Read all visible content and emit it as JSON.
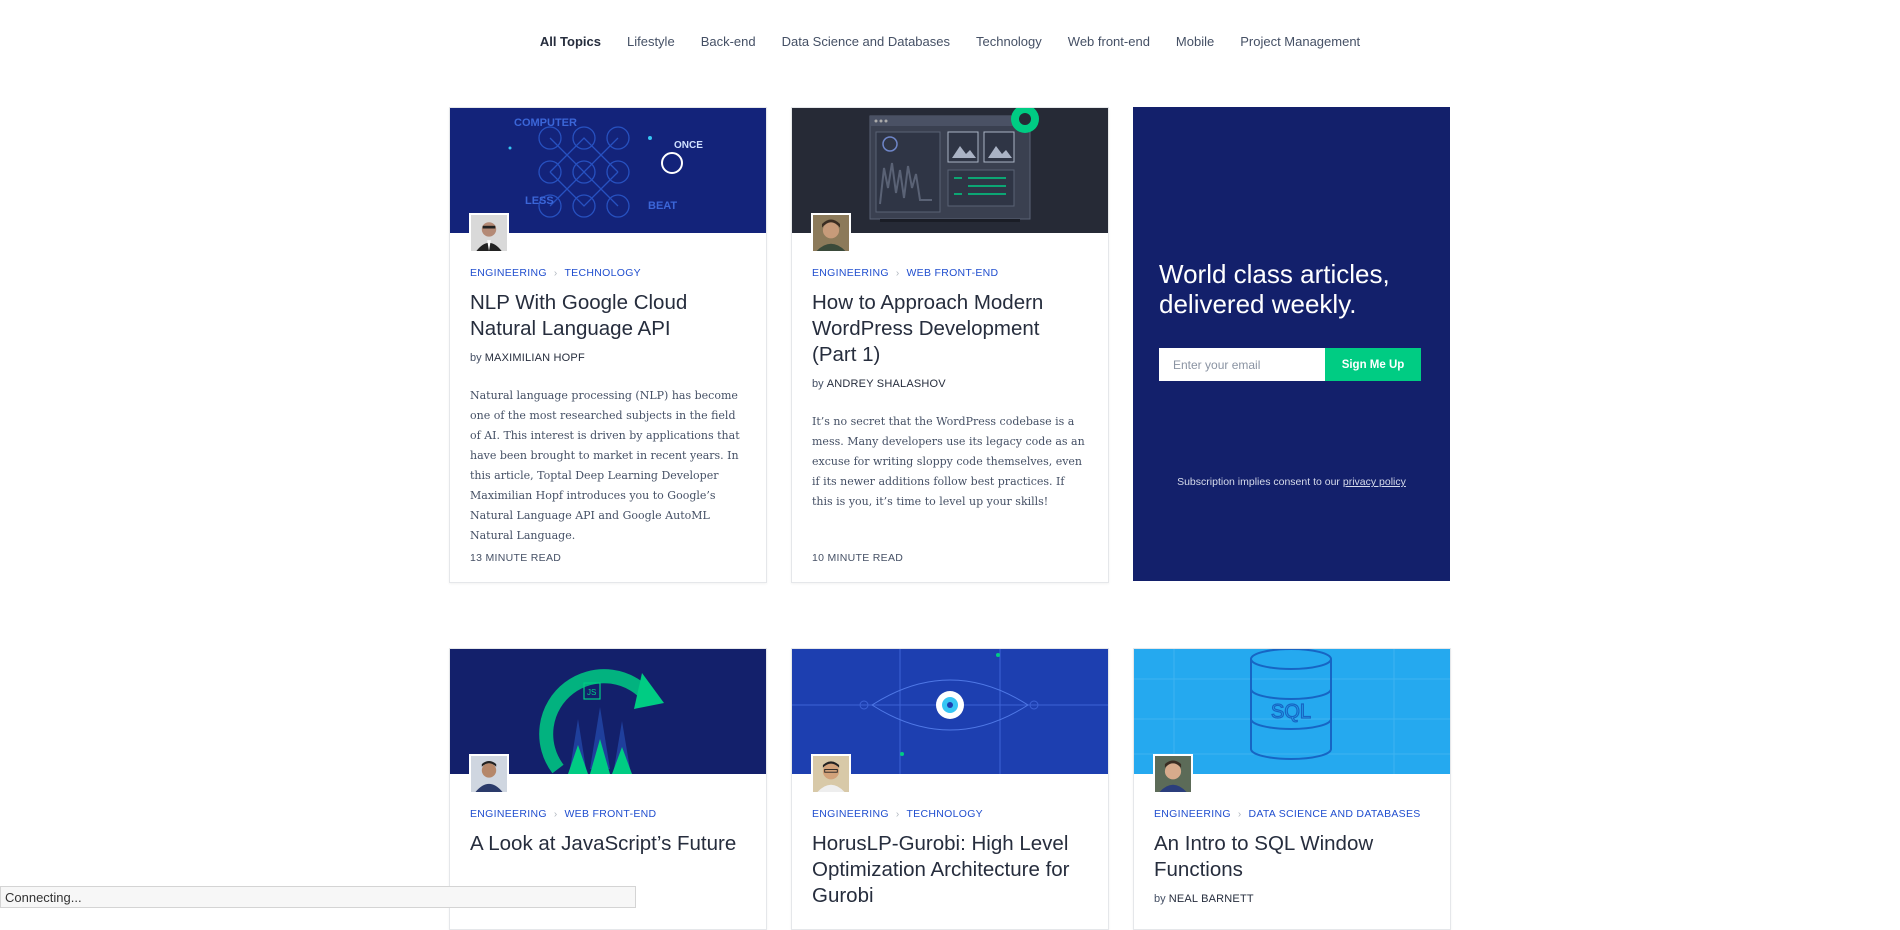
{
  "nav": {
    "topics": [
      "All Topics",
      "Lifestyle",
      "Back-end",
      "Data Science and Databases",
      "Technology",
      "Web front-end",
      "Mobile",
      "Project Management"
    ]
  },
  "cards": [
    {
      "categories": [
        "Engineering",
        "Technology"
      ],
      "title": "NLP With Google Cloud Natural Language API",
      "by": "by",
      "author": "Maximilian Hopf",
      "excerpt": "Natural language processing (NLP) has become one of the most researched subjects in the field of AI. This interest is driven by applications that have been brought to market in recent years. In this article, Toptal Deep Learning Developer Maximilian Hopf introduces you to Google’s Natural Language API and Google AutoML Natural Language.",
      "read_time": "13 minute read",
      "hero_text": [
        "COMPUTER",
        "ONCE",
        "LESS",
        "BEAT"
      ]
    },
    {
      "categories": [
        "Engineering",
        "Web front-end"
      ],
      "title": "How to Approach Modern WordPress Development (Part 1)",
      "by": "by",
      "author": "Andrey Shalashov",
      "excerpt": "It’s no secret that the WordPress codebase is a mess. Many developers use its legacy code as an excuse for writing sloppy code themselves, even if its newer additions follow best practices. If this is you, it’s time to level up your skills!",
      "read_time": "10 minute read"
    },
    {
      "categories": [
        "Engineering",
        "Web front-end"
      ],
      "title": "A Look at JavaScript’s Future",
      "hero_text": [
        "JS"
      ]
    },
    {
      "categories": [
        "Engineering",
        "Technology"
      ],
      "title": "HorusLP-Gurobi: High Level Optimization Architecture for Gurobi"
    },
    {
      "categories": [
        "Engineering",
        "Data Science and Databases"
      ],
      "title": "An Intro to SQL Window Functions",
      "by": "by",
      "author": "Neal Barnett",
      "hero_text": [
        "SQL"
      ]
    }
  ],
  "signup": {
    "headline": "World class articles, delivered weekly.",
    "email_placeholder": "Enter your email",
    "button_label": "Sign Me Up",
    "consent_text": "Subscription implies consent to our",
    "privacy_link": "privacy policy"
  },
  "status_bar": "Connecting...",
  "colors": {
    "accent_blue": "#204ecf",
    "navy": "#13206b",
    "green": "#00cc83",
    "sky": "#25a9ef"
  }
}
